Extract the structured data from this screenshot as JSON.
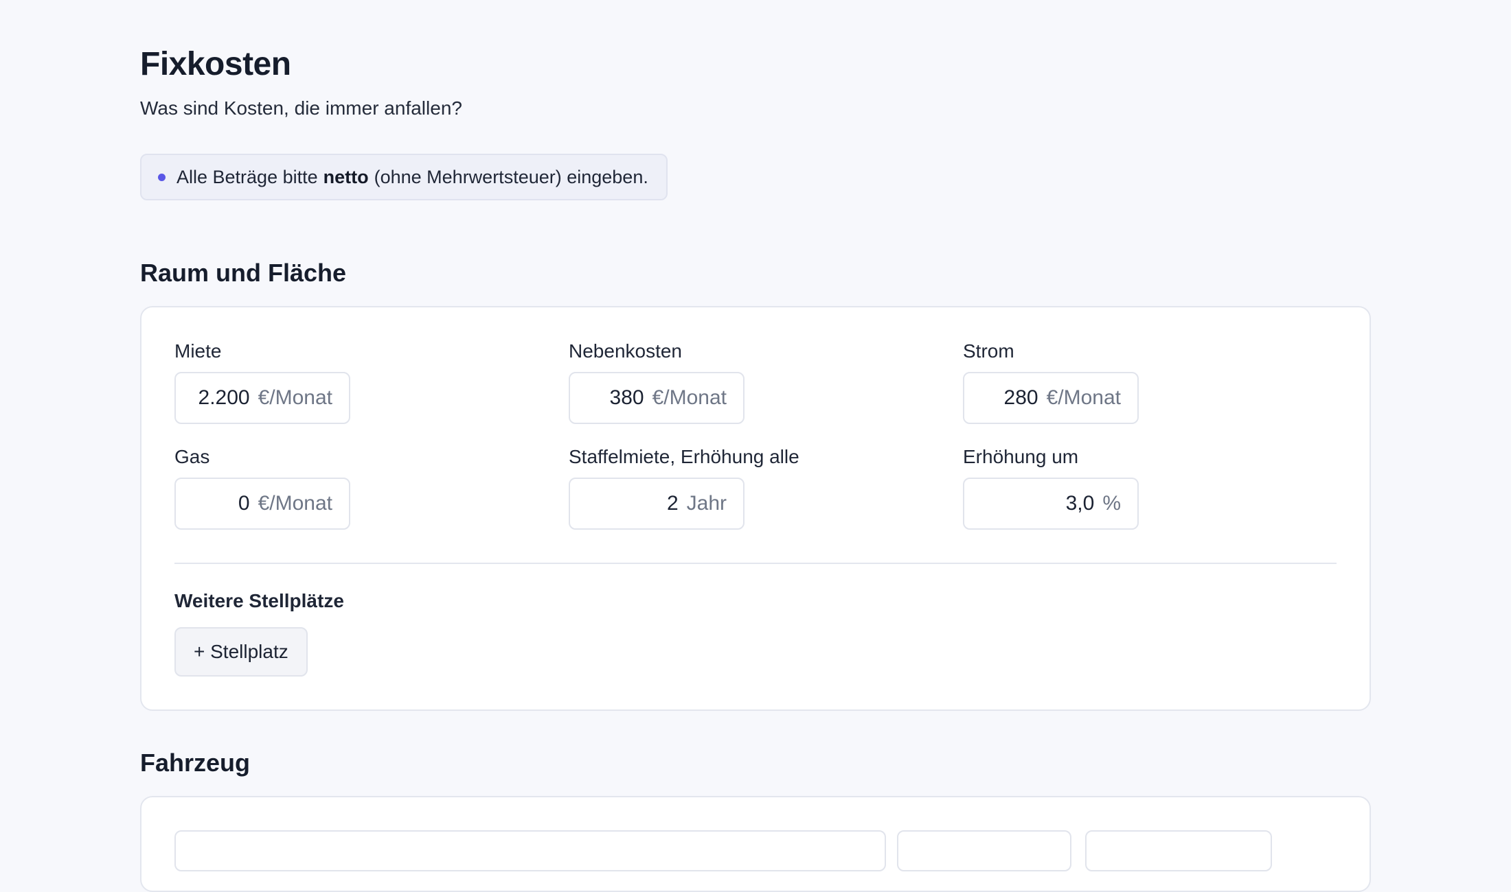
{
  "page": {
    "title": "Fixkosten",
    "subtitle": "Was sind Kosten, die immer anfallen?"
  },
  "notice": {
    "before": "Alle Beträge bitte",
    "bold": "netto",
    "after": "(ohne Mehrwertsteuer) eingeben."
  },
  "raum": {
    "title": "Raum und Fläche",
    "fields": [
      {
        "label": "Miete",
        "value": "2.200",
        "unit": "€/Monat"
      },
      {
        "label": "Nebenkosten",
        "value": "380",
        "unit": "€/Monat"
      },
      {
        "label": "Strom",
        "value": "280",
        "unit": "€/Monat"
      },
      {
        "label": "Gas",
        "value": "0",
        "unit": "€/Monat"
      },
      {
        "label": "Staffelmiete, Erhöhung alle",
        "value": "2",
        "unit": "Jahr"
      },
      {
        "label": "Erhöhung um",
        "value": "3,0",
        "unit": "%"
      }
    ],
    "parking": {
      "title": "Weitere Stellplätze",
      "add_label": "+ Stellplatz"
    }
  },
  "fahrzeug": {
    "title": "Fahrzeug"
  },
  "colors": {
    "accent": "#5a57e6",
    "background": "#f7f8fc",
    "card": "#ffffff",
    "border": "#e3e6ee"
  }
}
